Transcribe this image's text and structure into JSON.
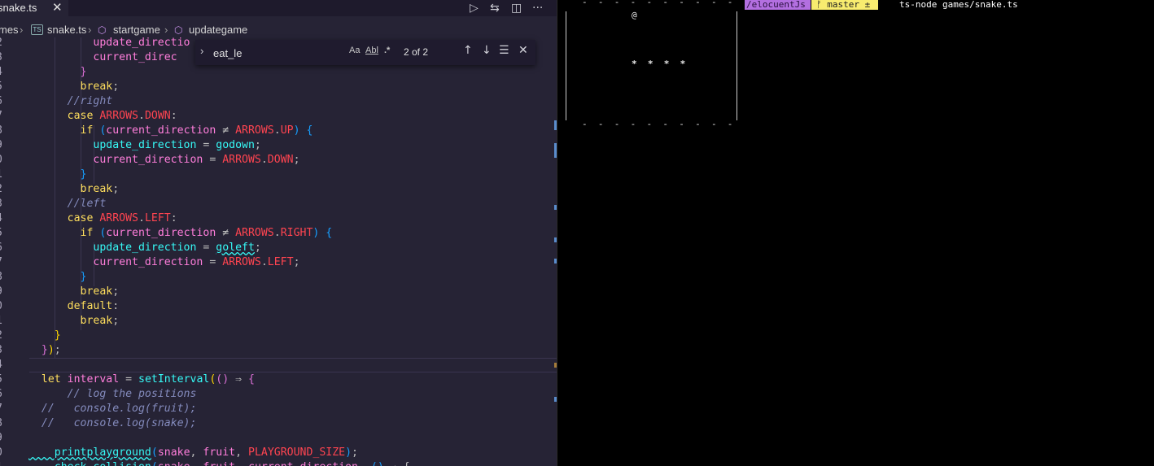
{
  "editor": {
    "tab": {
      "filename": "snake.ts",
      "close": "✕"
    },
    "actions": {
      "run": "▷",
      "compare": "⇆",
      "split": "◫",
      "more": "···"
    },
    "breadcrumb": {
      "folder": "mes",
      "sep": "›",
      "ts_badge": "TS",
      "file": "snake.ts",
      "scope1": "startgame",
      "scope2": "updategame"
    },
    "find": {
      "toggle": "›",
      "query": "eat_le",
      "match_case": "Aa",
      "whole_word": "Abl",
      "regex": ".*",
      "count": "2 of 2",
      "prev": "↑",
      "next": "↓",
      "selection": "☰",
      "close": "✕"
    },
    "lines": [
      {
        "n": "2",
        "t": [
          [
            "v",
            "          update_directio"
          ]
        ]
      },
      {
        "n": "3",
        "t": [
          [
            "v",
            "          current_direc"
          ]
        ]
      },
      {
        "n": "4",
        "t": [
          [
            "b2",
            "        }"
          ]
        ]
      },
      {
        "n": "5",
        "t": [
          [
            "k",
            "        break"
          ],
          [
            "p",
            ";"
          ]
        ]
      },
      {
        "n": "6",
        "t": [
          [
            "cm",
            "      //right"
          ]
        ]
      },
      {
        "n": "7",
        "t": [
          [
            "k",
            "      case "
          ],
          [
            "c",
            "ARROWS"
          ],
          [
            "p",
            "."
          ],
          [
            "c",
            "DOWN"
          ],
          [
            "p",
            ":"
          ]
        ]
      },
      {
        "n": "8",
        "t": [
          [
            "k",
            "        if "
          ],
          [
            "b3",
            "("
          ],
          [
            "v",
            "current_direction "
          ],
          [
            "p",
            "≠ "
          ],
          [
            "c",
            "ARROWS"
          ],
          [
            "p",
            "."
          ],
          [
            "c",
            "UP"
          ],
          [
            "b3",
            ")"
          ],
          [
            "b3",
            " {"
          ]
        ]
      },
      {
        "n": "9",
        "t": [
          [
            "f",
            "          update_direction"
          ],
          [
            "p",
            " = "
          ],
          [
            "f",
            "godown"
          ],
          [
            "p",
            ";"
          ]
        ]
      },
      {
        "n": "0",
        "t": [
          [
            "v",
            "          current_direction"
          ],
          [
            "p",
            " = "
          ],
          [
            "c",
            "ARROWS"
          ],
          [
            "p",
            "."
          ],
          [
            "c",
            "DOWN"
          ],
          [
            "p",
            ";"
          ]
        ]
      },
      {
        "n": "1",
        "t": [
          [
            "b3",
            "        }"
          ]
        ]
      },
      {
        "n": "2",
        "t": [
          [
            "k",
            "        break"
          ],
          [
            "p",
            ";"
          ]
        ]
      },
      {
        "n": "3",
        "t": [
          [
            "cm",
            "      //left"
          ]
        ]
      },
      {
        "n": "4",
        "t": [
          [
            "k",
            "      case "
          ],
          [
            "c",
            "ARROWS"
          ],
          [
            "p",
            "."
          ],
          [
            "c",
            "LEFT"
          ],
          [
            "p",
            ":"
          ]
        ]
      },
      {
        "n": "5",
        "t": [
          [
            "k",
            "        if "
          ],
          [
            "b3",
            "("
          ],
          [
            "v",
            "current_direction "
          ],
          [
            "p",
            "≠ "
          ],
          [
            "c",
            "ARROWS"
          ],
          [
            "p",
            "."
          ],
          [
            "c",
            "RIGHT"
          ],
          [
            "b3",
            ")"
          ],
          [
            "b3",
            " {"
          ]
        ]
      },
      {
        "n": "6",
        "t": [
          [
            "f",
            "          update_direction"
          ],
          [
            "p",
            " = "
          ],
          [
            "fsq",
            "goleft"
          ],
          [
            "p",
            ";"
          ]
        ]
      },
      {
        "n": "7",
        "t": [
          [
            "v",
            "          current_direction"
          ],
          [
            "p",
            " = "
          ],
          [
            "c",
            "ARROWS"
          ],
          [
            "p",
            "."
          ],
          [
            "c",
            "LEFT"
          ],
          [
            "p",
            ";"
          ]
        ]
      },
      {
        "n": "8",
        "t": [
          [
            "b3",
            "        }"
          ]
        ]
      },
      {
        "n": "9",
        "t": [
          [
            "k",
            "        break"
          ],
          [
            "p",
            ";"
          ]
        ]
      },
      {
        "n": "0",
        "t": [
          [
            "k",
            "      default"
          ],
          [
            "p",
            ":"
          ]
        ]
      },
      {
        "n": "1",
        "t": [
          [
            "k",
            "        break"
          ],
          [
            "p",
            ";"
          ]
        ]
      },
      {
        "n": "2",
        "t": [
          [
            "b1",
            "    }"
          ]
        ]
      },
      {
        "n": "3",
        "t": [
          [
            "b2",
            "  }"
          ],
          [
            "b1",
            ")"
          ],
          [
            "p",
            ";"
          ]
        ]
      },
      {
        "n": "4",
        "t": [
          [
            "p",
            ""
          ]
        ]
      },
      {
        "n": "5",
        "t": [
          [
            "k",
            "  let "
          ],
          [
            "v",
            "interval"
          ],
          [
            "p",
            " = "
          ],
          [
            "f",
            "setInterval"
          ],
          [
            "b1",
            "("
          ],
          [
            "b2",
            "()"
          ],
          [
            "p",
            " ⇒ "
          ],
          [
            "b2",
            "{"
          ]
        ]
      },
      {
        "n": "6",
        "t": [
          [
            "cm",
            "      // log the positions"
          ]
        ]
      },
      {
        "n": "7",
        "t": [
          [
            "cm",
            "  //   console.log(fruit);"
          ]
        ]
      },
      {
        "n": "8",
        "t": [
          [
            "cm",
            "  //   console.log(snake);"
          ]
        ]
      },
      {
        "n": "9",
        "t": [
          [
            "p",
            ""
          ]
        ]
      },
      {
        "n": "0",
        "t": [
          [
            "fsq",
            "    printplayground"
          ],
          [
            "b3",
            "("
          ],
          [
            "v",
            "snake"
          ],
          [
            "p",
            ", "
          ],
          [
            "v",
            "fruit"
          ],
          [
            "p",
            ", "
          ],
          [
            "c",
            "PLAYGROUND_SIZE"
          ],
          [
            "b3",
            ")"
          ],
          [
            "p",
            ";"
          ]
        ]
      },
      {
        "n": "1",
        "t": [
          [
            "f",
            "    check_collision"
          ],
          [
            "b3",
            "("
          ],
          [
            "v",
            "snake"
          ],
          [
            "p",
            ", "
          ],
          [
            "v",
            "fruit"
          ],
          [
            "p",
            ", "
          ],
          [
            "v",
            "current_direction"
          ],
          [
            "p",
            ", "
          ],
          [
            "b3",
            "()"
          ],
          [
            "p",
            " ⇒ {"
          ]
        ]
      }
    ]
  },
  "terminal": {
    "border_top": "-  -  -  -  -  -  -  -  -  -",
    "border_bottom": "-  -  -  -  -  -  -  -  -  -",
    "fruit": "@",
    "snake": "*  *  *  *",
    "prompt_path": "/elocuentJs",
    "prompt_branch": "ᚠ master ±",
    "command": "ts-node games/snake.ts"
  }
}
